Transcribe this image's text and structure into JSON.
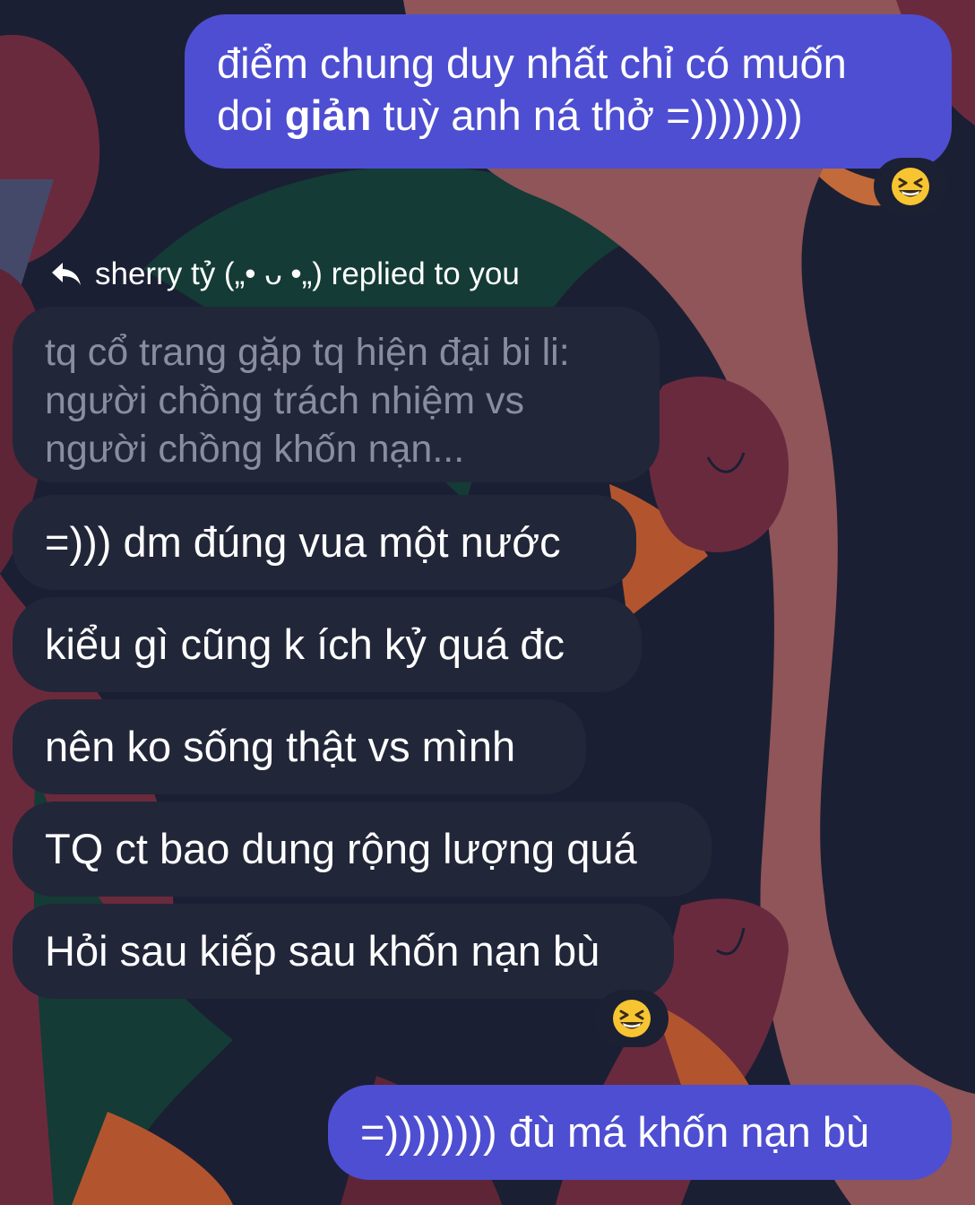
{
  "conversation": {
    "outgoing_1": {
      "line1": "điểm chung duy nhất chỉ có muốn",
      "line2_start": "doi ",
      "line2_bold": "giản",
      "line2_end": " tuỳ anh ná thở =))))))))"
    },
    "reaction_1": "grinning-squinting-face-icon",
    "reply_header": {
      "icon": "reply-arrow-icon",
      "text": "sherry tỷ („• ᴗ •„) replied to you"
    },
    "quoted_message": {
      "lines": [
        "tq cổ trang gặp tq hiện đại bi li:",
        "người chồng trách nhiệm vs",
        "người chồng khốn nạn..."
      ]
    },
    "incoming": [
      "=))) dm đúng vua một nước",
      "kiểu gì cũng k ích kỷ quá đc",
      "nên ko sống thật vs mình",
      "TQ ct bao dung rộng lượng quá",
      "Hỏi sau kiếp sau khốn nạn bù"
    ],
    "reaction_2": "grinning-squinting-face-icon",
    "outgoing_2": "=)))))))) đù má khốn nạn bù"
  },
  "colors": {
    "outgoing_bubble": "#4e4ed2",
    "incoming_bubble": "#222639",
    "quoted_text": "#8a8d9e",
    "background": "#1b1f33"
  }
}
